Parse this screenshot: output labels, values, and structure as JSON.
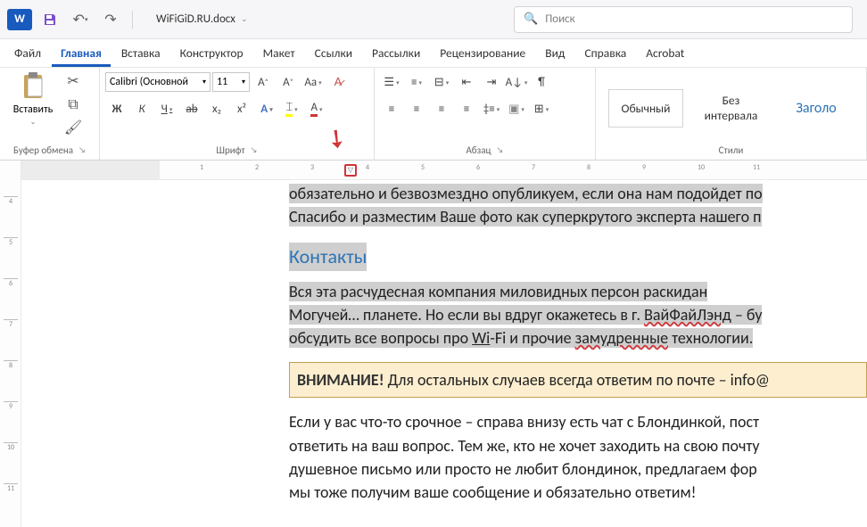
{
  "title": {
    "doc_name": "WiFiGiD.RU.docx"
  },
  "search": {
    "placeholder": "Поиск"
  },
  "tabs": [
    "Файл",
    "Главная",
    "Вставка",
    "Конструктор",
    "Макет",
    "Ссылки",
    "Рассылки",
    "Рецензирование",
    "Вид",
    "Справка",
    "Acrobat"
  ],
  "active_tab": 1,
  "ribbon": {
    "clipboard": {
      "paste": "Вставить",
      "label": "Буфер обмена"
    },
    "font": {
      "name": "Calibri (Основной",
      "size": "11",
      "label": "Шрифт",
      "bold": "Ж",
      "italic": "К",
      "underline": "Ч",
      "strike": "ab",
      "sub": "x₂",
      "sup": "x²"
    },
    "paragraph": {
      "label": "Абзац"
    },
    "styles": {
      "label": "Стили",
      "items": [
        "Обычный",
        "Без интервала",
        "Заголо"
      ]
    }
  },
  "ruler": {
    "marks": [
      1,
      2,
      3,
      4,
      5,
      6,
      7,
      8,
      9,
      10,
      11
    ],
    "vmarks": [
      4,
      5,
      6,
      7,
      8,
      9,
      10,
      11
    ]
  },
  "doc": {
    "p1a": "обязательно и безвозмездно опубликуем, если она нам подойдет по",
    "p1b": "Спасибо и разместим Ваше фото как суперкрутого эксперта нашего п",
    "heading": "Контакты",
    "p2a_indent": "        Вся эта расчудесная компания миловидных персон раскидан",
    "p2b_pre": "Могучей… планете. Но если вы вдруг окажетесь в г. ",
    "p2b_wavy": "ВайФайЛэнд",
    "p2b_post": " – бу",
    "p2c_pre": "обсудить все вопросы про ",
    "p2c_u1": "Wi",
    "p2c_mid": "-Fi и прочие ",
    "p2c_wavy2": "замудренные",
    "p2c_post": " технологии.",
    "notice_bold": "ВНИМАНИЕ!",
    "notice_rest": " Для остальных случаев всегда ответим по почте – info@",
    "p3a": "Если у вас что-то срочное – справа внизу есть чат с Блондинкой, пост",
    "p3b": "ответить на ваш вопрос. Тем же, кто не хочет заходить на свою почту",
    "p3c": "душевное письмо или просто не любит блондинок, предлагаем фор",
    "p3d": "мы тоже получим ваше сообщение и обязательно ответим!"
  }
}
